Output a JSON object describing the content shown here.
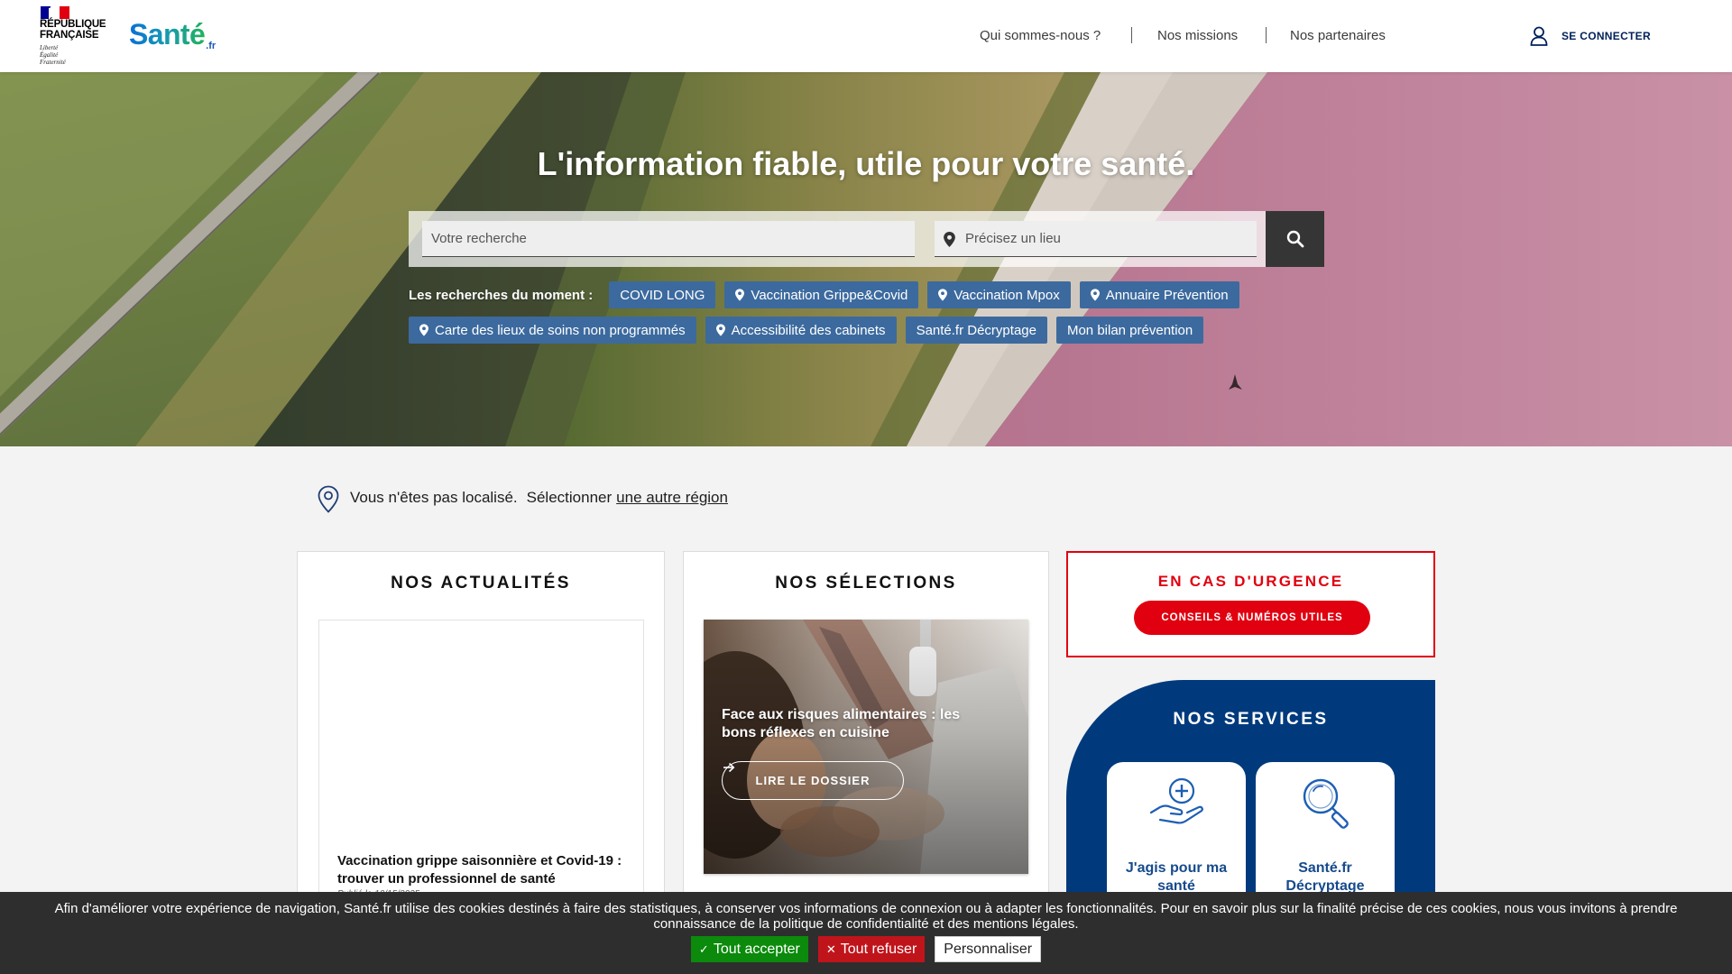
{
  "header": {
    "gov_logo": {
      "line1": "RÉPUBLIQUE",
      "line2": "FRANÇAISE",
      "motto": [
        "Liberté",
        "Égalité",
        "Fraternité"
      ],
      "icon": "marianne-icon"
    },
    "site_logo": {
      "name": "Santé",
      "suffix": ".fr"
    },
    "nav": [
      {
        "label": "Qui sommes-nous ?"
      },
      {
        "label": "Nos missions"
      },
      {
        "label": "Nos partenaires"
      }
    ],
    "login": {
      "label": "SE CONNECTER",
      "icon": "user-icon"
    }
  },
  "hero": {
    "title": "L'information fiable, utile pour votre santé.",
    "search": {
      "placeholder": "Votre recherche"
    },
    "location": {
      "placeholder": "Précisez un lieu",
      "icon": "map-pin-icon"
    },
    "search_button_icon": "search-icon",
    "trending": {
      "label": "Les recherches du moment :",
      "tags": [
        {
          "label": "COVID LONG"
        },
        {
          "label": "Vaccination Grippe&Covid",
          "icon": "map-pin-icon"
        },
        {
          "label": "Vaccination Mpox",
          "icon": "map-pin-icon"
        },
        {
          "label": "Annuaire Prévention",
          "icon": "map-pin-icon"
        },
        {
          "label": "Carte des lieux de soins non programmés",
          "icon": "map-pin-icon"
        },
        {
          "label": "Accessibilité des cabinets",
          "icon": "map-pin-icon"
        },
        {
          "label": "Santé.fr Décryptage"
        },
        {
          "label": "Mon bilan prévention"
        }
      ]
    }
  },
  "location_bar": {
    "status": "Vous n'êtes pas localisé.",
    "prompt": "Sélectionner",
    "link": "une autre région",
    "icon": "location-pin-icon"
  },
  "news": {
    "title": "NOS ACTUALITÉS",
    "items": [
      {
        "title": "Vaccination grippe saisonnière et Covid-19 : trouver un professionnel de santé",
        "date": "Publié le 10/15/2025"
      }
    ]
  },
  "selections": {
    "title": "NOS SÉLECTIONS",
    "items": [
      {
        "title": "Face aux risques alimentaires : les bons réflexes en cuisine",
        "cta": "LIRE LE DOSSIER",
        "cta_icon": "arrow-right-icon"
      }
    ]
  },
  "emergency": {
    "title": "EN CAS D'URGENCE",
    "button": "CONSEILS & NUMÉROS UTILES"
  },
  "services": {
    "title": "NOS SERVICES",
    "items": [
      {
        "label": "J'agis pour ma santé",
        "icon": "hand-plus-icon"
      },
      {
        "label": "Santé.fr Décryptage",
        "icon": "magnifier-icon"
      }
    ]
  },
  "cookie_banner": {
    "text": "Afin d'améliorer votre expérience de navigation, Santé.fr utilise des cookies destinés à faire des statistiques, à conserver vos informations de connexion ou à adapter les fonctionnalités. Pour en savoir plus sur la finalité précise de ces cookies, nous vous invitons à prendre connaissance de la politique de confidentialité et des mentions légales.",
    "buttons": [
      {
        "label": "Tout accepter",
        "icon": "check-icon"
      },
      {
        "label": "Tout refuser",
        "icon": "close-icon"
      },
      {
        "label": "Personnaliser"
      }
    ]
  },
  "colors": {
    "header_bg": "#ffffff",
    "tag_blue": "#3c6a9e",
    "services_blue": "#003a7d",
    "urgent_red": "#e1000f",
    "accept_green": "#0b8a0b",
    "refuse_red": "#c0141b",
    "banner_bg": "#2e2e2e",
    "page_bg": "#f3f3f3"
  }
}
